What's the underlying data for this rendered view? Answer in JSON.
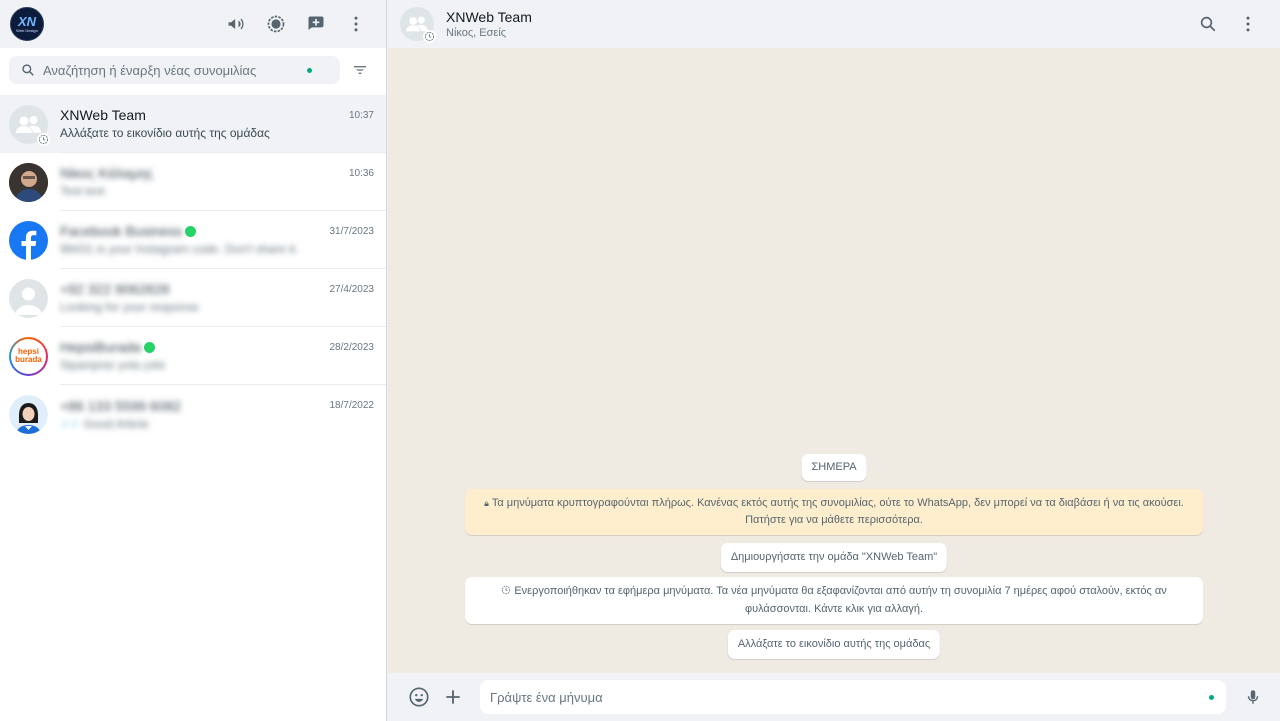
{
  "sidebar": {
    "logo": {
      "main": "XN",
      "sub": "Web Design"
    },
    "header_icons": [
      "megaphone-icon",
      "status-icon",
      "new-chat-icon",
      "menu-icon"
    ],
    "search": {
      "placeholder": "Αναζήτηση ή έναρξη νέας συνομιλίας"
    },
    "chats": [
      {
        "name": "XNWeb Team",
        "time": "10:37",
        "message": "Αλλάξατε το εικονίδιο αυτής της ομάδας",
        "avatar": "group-avatar"
      },
      {
        "name": "Νίκος Κάλαμης",
        "time": "10:36",
        "message": "Test test",
        "avatar": "photo-man"
      },
      {
        "name": "Facebook Business",
        "time": "31/7/2023",
        "message": "98431 is your Instagram code. Don't share it.",
        "avatar": "facebook-logo"
      },
      {
        "name": "+92 322 9062828",
        "time": "27/4/2023",
        "message": "Looking for your response",
        "avatar": "default-avatar"
      },
      {
        "name": "HepsiBurada",
        "time": "28/2/2023",
        "message": "Siparişiniz yola çıktı",
        "avatar": "hepsiburada-logo"
      },
      {
        "name": "+86 133 5599 6082",
        "time": "18/7/2022",
        "message": "Good Article",
        "avatar": "photo-woman"
      }
    ]
  },
  "main": {
    "header": {
      "title": "XNWeb Team",
      "subtitle": "Νίκος, Εσείς"
    },
    "messages": {
      "date": "ΣΗΜΕΡΑ",
      "encryption": "Τα μηνύματα κρυπτογραφούνται πλήρως. Κανένας εκτός αυτής της συνομιλίας, ούτε το WhatsApp, δεν μπορεί να τα διαβάσει ή να τις ακούσει. Πατήστε για να μάθετε περισσότερα.",
      "created": "Δημιουργήσατε την ομάδα \"XNWeb Team\"",
      "ephemeral": "Ενεργοποιήθηκαν τα εφήμερα μηνύματα. Τα νέα μηνύματα θα εξαφανίζονται από αυτήν τη συνομιλία 7 ημέρες αφού σταλούν, εκτός αν φυλάσσονται. Κάντε κλικ για αλλαγή.",
      "icon_changed": "Αλλάξατε το εικονίδιο αυτής της ομάδας"
    },
    "composer": {
      "placeholder": "Γράψτε ένα μήνυμα"
    }
  },
  "colors": {
    "accent": "#00a884",
    "panel": "#f0f2f5",
    "chat_bg": "#efeae2",
    "encryption_bg": "#ffeecd"
  }
}
